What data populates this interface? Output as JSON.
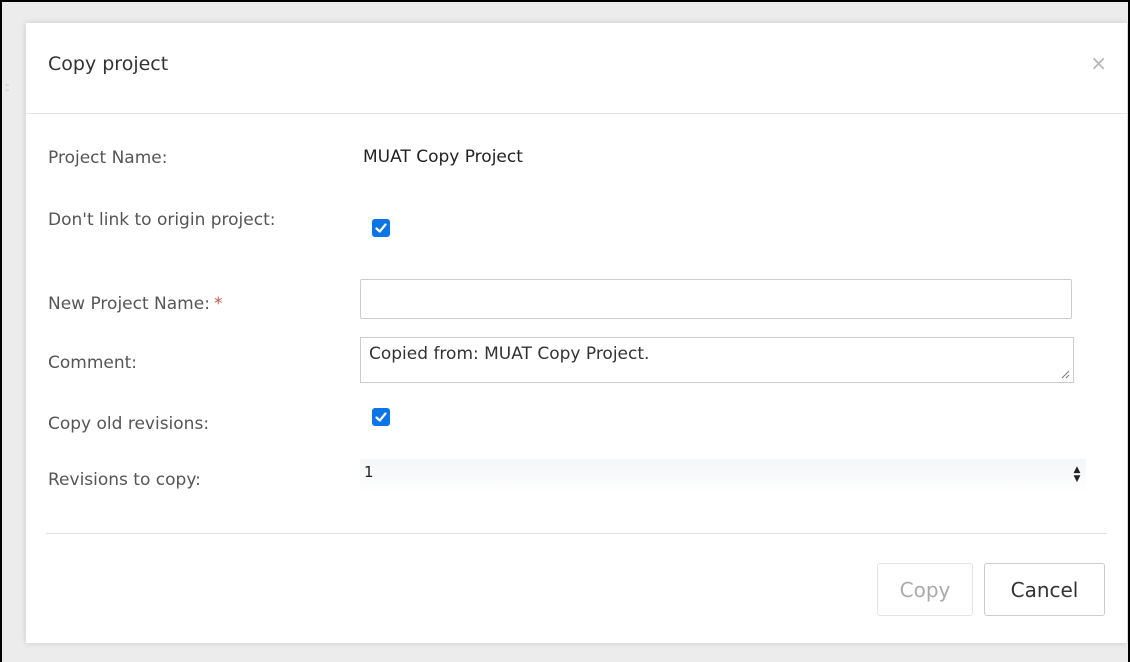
{
  "dialog": {
    "title": "Copy project",
    "close_glyph": "×"
  },
  "form": {
    "project_name_label": "Project Name:",
    "project_name_value": "MUAT Copy Project",
    "dont_link_label": "Don't link to origin project:",
    "dont_link_checked": true,
    "new_name_label": "New Project Name:",
    "new_name_required_mark": "*",
    "new_name_value": "",
    "comment_label": "Comment:",
    "comment_value": "Copied from: MUAT Copy Project.",
    "copy_old_label": "Copy old revisions:",
    "copy_old_checked": true,
    "revisions_label": "Revisions to copy:",
    "revisions_value": "1"
  },
  "buttons": {
    "copy_label": "Copy",
    "cancel_label": "Cancel"
  },
  "colors": {
    "checkbox_accent": "#0b74e6",
    "required_star": "#d9534f"
  }
}
